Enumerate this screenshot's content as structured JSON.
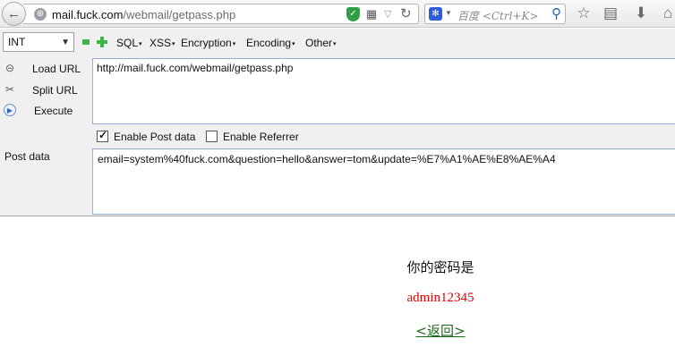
{
  "navbar": {
    "url_host": "mail.fuck.com",
    "url_path": "/webmail/getpass.php",
    "search_placeholder": "百度 <Ctrl+K>"
  },
  "hackbar": {
    "type_select": "INT",
    "menus": [
      "SQL",
      "XSS",
      "Encryption",
      "Encoding",
      "Other"
    ],
    "load_url": "Load URL",
    "split_url": "Split URL",
    "execute": "Execute",
    "url_value": "http://mail.fuck.com/webmail/getpass.php",
    "enable_post": {
      "label": "Enable Post data",
      "checked": true
    },
    "enable_referrer": {
      "label": "Enable Referrer",
      "checked": false
    },
    "post_label": "Post data",
    "post_value": "email=system%40fuck.com&question=hello&answer=tom&update=%E7%A1%AE%E8%AE%A4"
  },
  "page": {
    "message": "你的密码是",
    "password": "admin12345",
    "back_link": "<返回>"
  },
  "colors": {
    "password": "#e00000",
    "back_link": "#1b6b1b",
    "field_border": "#8fb0d9"
  },
  "icons": [
    "back-arrow-icon",
    "globe-icon",
    "shield-icon",
    "qr-code-icon",
    "reload-icon",
    "baidu-icon",
    "search-icon",
    "star-icon",
    "reading-list-icon",
    "download-icon",
    "home-icon",
    "load-url-icon",
    "split-url-icon",
    "execute-icon"
  ]
}
